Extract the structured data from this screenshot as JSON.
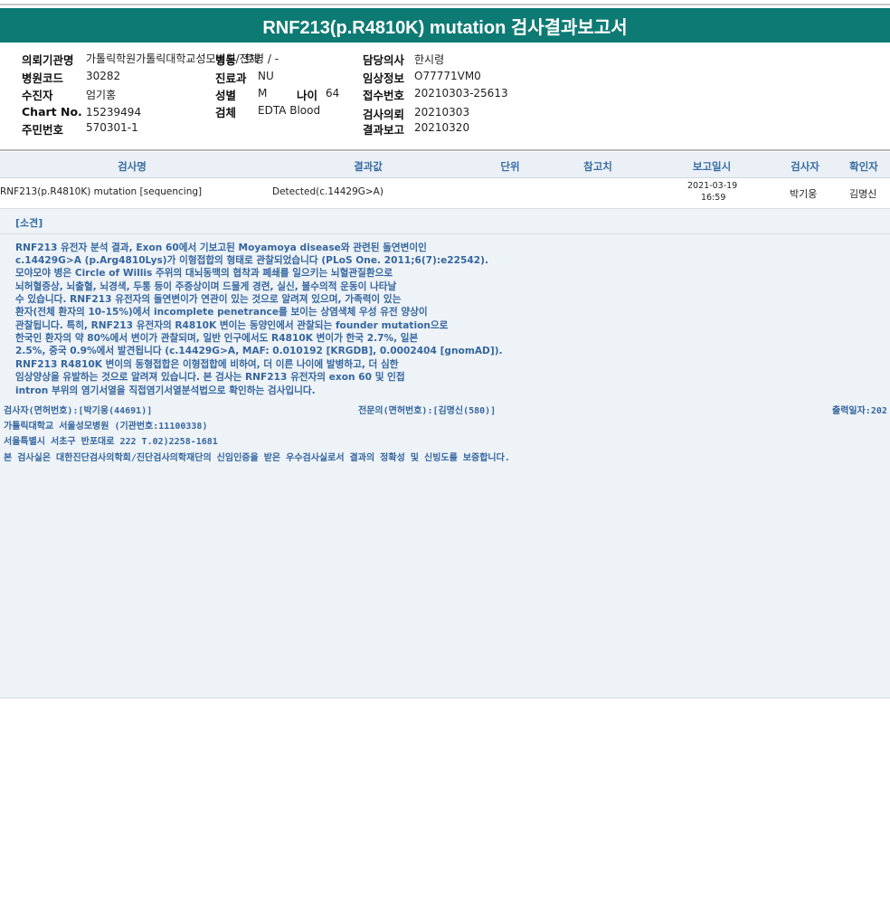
{
  "title": "RNF213(p.R4810K) mutation 검사결과보고서",
  "header": {
    "left": [
      {
        "label": "의뢰기관명",
        "value": "가톨릭학원가톨릭대학교성모병원/전체"
      },
      {
        "label": "병원코드",
        "value": "30282"
      },
      {
        "label": "수진자",
        "value": "엄기홍"
      },
      {
        "label": "Chart No.",
        "value": "15239494"
      },
      {
        "label": "주민번호",
        "value": "570301-1"
      }
    ],
    "ward_label": "병동",
    "ward_value": "트병 / -",
    "middle": [
      {
        "label": "진료과",
        "value": "NU"
      },
      {
        "label": "성별",
        "value": "M"
      },
      {
        "label": "검체",
        "value": "EDTA Blood"
      }
    ],
    "age_label": "나이",
    "age_value": "64",
    "right": [
      {
        "label": "담당의사",
        "value": "한시령"
      },
      {
        "label": "임상정보",
        "value": "O77771VM0"
      },
      {
        "label": "접수번호",
        "value": "20210303-25613"
      },
      {
        "label": "검사의뢰",
        "value": "20210303"
      },
      {
        "label": "결과보고",
        "value": "20210320"
      }
    ]
  },
  "table": {
    "headers": [
      "검사명",
      "결과값",
      "단위",
      "참고치",
      "보고일시",
      "검사자",
      "확인자"
    ],
    "rows": [
      {
        "test": "RNF213(p.R4810K) mutation [sequencing]",
        "result": "Detected(c.14429G>A)",
        "unit": "",
        "reference": "",
        "report_date": "2021-03-19",
        "report_time": "16:59",
        "tester": "박기웅",
        "confirmer": "김명신"
      }
    ]
  },
  "opinion": {
    "heading": "[소견]",
    "lines": [
      "RNF213 유전자 분석 결과, Exon 60에서 기보고된 Moyamoya disease와 관련된 돌연변이인",
      "c.14429G>A (p.Arg4810Lys)가 이형접합의 형태로 관찰되었습니다 (PLoS One. 2011;6(7):e22542).",
      "모야모야 병은 Circle of Willis 주위의 대뇌동맥의 협착과 폐쇄를 일으키는 뇌혈관질환으로",
      "뇌허혈증상, 뇌출혈, 뇌경색, 두통 등이 주증상이며 드물게 경련, 실신, 불수의적 운동이 나타날",
      "수 있습니다. RNF213 유전자의 돌연변이가 연관이 있는 것으로 알려져 있으며, 가족력이 있는",
      "환자(전체 환자의 10-15%)에서 incomplete penetrance를 보이는 상염색체 우성 유전 양상이",
      "관찰됩니다. 특히, RNF213 유전자의 R4810K 변이는 동양인에서 관찰되는 founder mutation으로",
      "한국인 환자의 약 80%에서 변이가 관찰되며, 일반 인구에서도 R4810K 변이가 한국 2.7%, 일본",
      "2.5%, 중국 0.9%에서 발견됩니다 (c.14429G>A, MAF: 0.010192 [KRGDB], 0.0002404 [gnomAD]).",
      "RNF213 R4810K 변이의 동형접합은 이형접합에 비하여, 더 이른 나이에 발병하고, 더 심한",
      "임상양상을 유발하는 것으로 알려져 있습니다. 본 검사는 RNF213 유전자의 exon 60 및 인접",
      "intron 부위의 염기서열을 직접염기서열분석법으로 확인하는 검사입니다."
    ]
  },
  "footer": {
    "tester_line": "검사자(면허번호):[박기웅(44691)]",
    "specialist_line": "전문의(면허번호):[김명신(580)]",
    "print_date": "출력일자:202",
    "institution": "가톨릭대학교 서울성모병원 (기관번호:11100338)",
    "address": "서울특별시 서초구 반포대로 222 T.02)2258-1681",
    "certification": "본 검사실은 대한진단검사의학회/진단검사의학재단의 신임인증을 받은 우수검사실로서 결과의 정확성 및 신빙도를 보증합니다."
  }
}
